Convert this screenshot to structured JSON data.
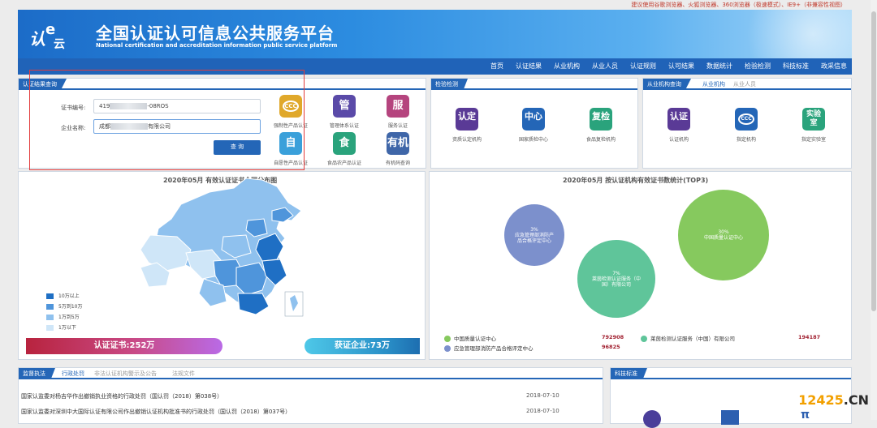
{
  "notice": "建议使用谷歌浏览器、火狐浏览器、360浏览器（极速模式）、IE9+（非兼容性视图）",
  "header": {
    "logo": {
      "m1": "认",
      "m2": "e",
      "m3": "云"
    },
    "title": "全国认证认可信息公共服务平台",
    "subtitle": "National certification and accreditation information public service platform"
  },
  "nav": [
    "首页",
    "认证结果",
    "从业机构",
    "从业人员",
    "认证规则",
    "认可结果",
    "数据统计",
    "检验检测",
    "科技标准",
    "政采信息"
  ],
  "query_panel": {
    "tab": "认证结果查询",
    "cert_label": "证书编号:",
    "cert_prefix": "419",
    "cert_suffix": "-08ROS",
    "company_label": "企业名称:",
    "company_prefix": "成都",
    "company_suffix": "有限公司",
    "search_button": "查 询",
    "icons": [
      {
        "glyph": "CCC",
        "caption": "强制性产品认证",
        "color": "#e0a82a"
      },
      {
        "glyph": "管",
        "caption": "管理体系认证",
        "color": "#5a4aa8"
      },
      {
        "glyph": "服",
        "caption": "服务认证",
        "color": "#b5447e"
      },
      {
        "glyph": "自",
        "caption": "自愿性产品认证",
        "color": "#3aa0da"
      },
      {
        "glyph": "食",
        "caption": "食品农产品认证",
        "color": "#2aa37c"
      },
      {
        "glyph": "有机",
        "caption": "有机码查询",
        "color": "#3f66a8"
      }
    ]
  },
  "inspection_panel": {
    "tab": "检验检测",
    "icons": [
      {
        "glyph": "认定",
        "caption": "资质认定机构",
        "color": "#5a3a96"
      },
      {
        "glyph": "中心",
        "caption": "国家质检中心",
        "color": "#2466b7"
      },
      {
        "glyph": "复检",
        "caption": "食品复检机构",
        "color": "#2aa37c"
      }
    ]
  },
  "agency_panel": {
    "tabs": [
      "从业机构查询",
      "从业机构",
      "从业人员"
    ],
    "icons": [
      {
        "glyph": "认证",
        "caption": "认证机构",
        "color": "#5a3a96"
      },
      {
        "glyph": "CCC",
        "caption": "指定机构",
        "color": "#2466b7"
      },
      {
        "glyph": "实验室",
        "caption": "指定实验室",
        "color": "#2aa37c"
      }
    ]
  },
  "map_section": {
    "title": "2020年05月  有效认证证书全国分布图",
    "legend": [
      {
        "label": "10万以上",
        "color": "#1f6fc4"
      },
      {
        "label": "5万到10万",
        "color": "#4f95db"
      },
      {
        "label": "1万到5万",
        "color": "#8fc1ee"
      },
      {
        "label": "1万以下",
        "color": "#cfe6f8"
      }
    ],
    "cert_total": "认证证书:252万",
    "enterprise_total": "获证企业:73万"
  },
  "top3_section": {
    "title": "2020年05月   按认证机构有效证书数统计(TOP3)",
    "items": [
      {
        "pct": "30%",
        "name": "中国质量认证中心",
        "value": "792908",
        "color": "#86c95e"
      },
      {
        "pct": "7%",
        "name": "莱茵检测认证服务（中国）有限公司",
        "value": "194187",
        "color": "#5fc59a"
      },
      {
        "pct": "3%",
        "name": "应急管理部消防产品合格评定中心",
        "value": "96825",
        "color": "#7c90cc"
      }
    ]
  },
  "supervision_panel": {
    "tabs": [
      "监督执法",
      "行政处罚",
      "非法认证机构警示及公告",
      "法规文件"
    ],
    "news": [
      {
        "title": "国家认监委对杨吉华作出撤销执业资格的行政处罚（国认罚（2018）第038号）",
        "date": "2018-07-10"
      },
      {
        "title": "国家认监委对深圳中大国际认证有限公司作出撤销认证机构批准书的行政处罚（国认罚（2018）第037号）",
        "date": "2018-07-10"
      }
    ]
  },
  "tech_panel": {
    "tab": "科技标准"
  },
  "watermark": {
    "num": "12425",
    "suffix": ".CN"
  }
}
